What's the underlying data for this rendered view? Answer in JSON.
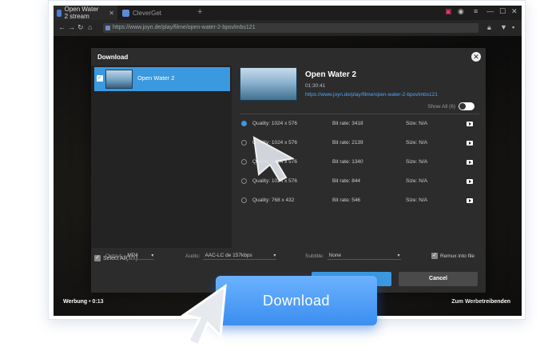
{
  "browser": {
    "tabs": [
      {
        "label": "Open Water 2 stream"
      },
      {
        "label": "CleverGet"
      }
    ],
    "new_tab": "+",
    "url": "https://www.joyn.de/play/filme/open-water-2-bpsvlmbs121"
  },
  "player": {
    "ad_label": "Werbung • 0:13",
    "ad_link": "Zum Werbetreibenden"
  },
  "dialog": {
    "title": "Download",
    "close_symbol": "✕",
    "items": [
      {
        "label": "Open Water 2",
        "checked": true
      }
    ],
    "select_all": "Select All(1/1)",
    "media": {
      "title": "Open Water 2",
      "duration": "01:30:41",
      "url": "https://www.joyn.de/play/filme/open-water-2-bpsvlmbs121"
    },
    "show_all": "Show All (6)",
    "qualities": [
      {
        "quality": "Quality: 1024 x 576",
        "bitrate": "Bit rate: 3418",
        "size": "Size: N/A",
        "selected": true
      },
      {
        "quality": "Quality: 1024 x 576",
        "bitrate": "Bit rate: 2139",
        "size": "Size: N/A",
        "selected": false
      },
      {
        "quality": "Quality: 1024 x 576",
        "bitrate": "Bit rate: 1340",
        "size": "Size: N/A",
        "selected": false
      },
      {
        "quality": "Quality: 1024 x 576",
        "bitrate": "Bit rate: 844",
        "size": "Size: N/A",
        "selected": false
      },
      {
        "quality": "Quality: 768 x 432",
        "bitrate": "Bit rate: 546",
        "size": "Size: N/A",
        "selected": false
      }
    ],
    "output_label": "Output:",
    "output_value": "MP4",
    "audio_label": "Audio:",
    "audio_value": "AAC-LC de 157kbps",
    "subtitle_label": "Subtitle:",
    "subtitle_value": "None",
    "remux_label": "Remux into file",
    "cancel_label": "Cancel"
  },
  "overlay": {
    "download_label": "Download"
  },
  "colors": {
    "accent": "#3b99e0",
    "big_button": "#3b8ef0"
  }
}
